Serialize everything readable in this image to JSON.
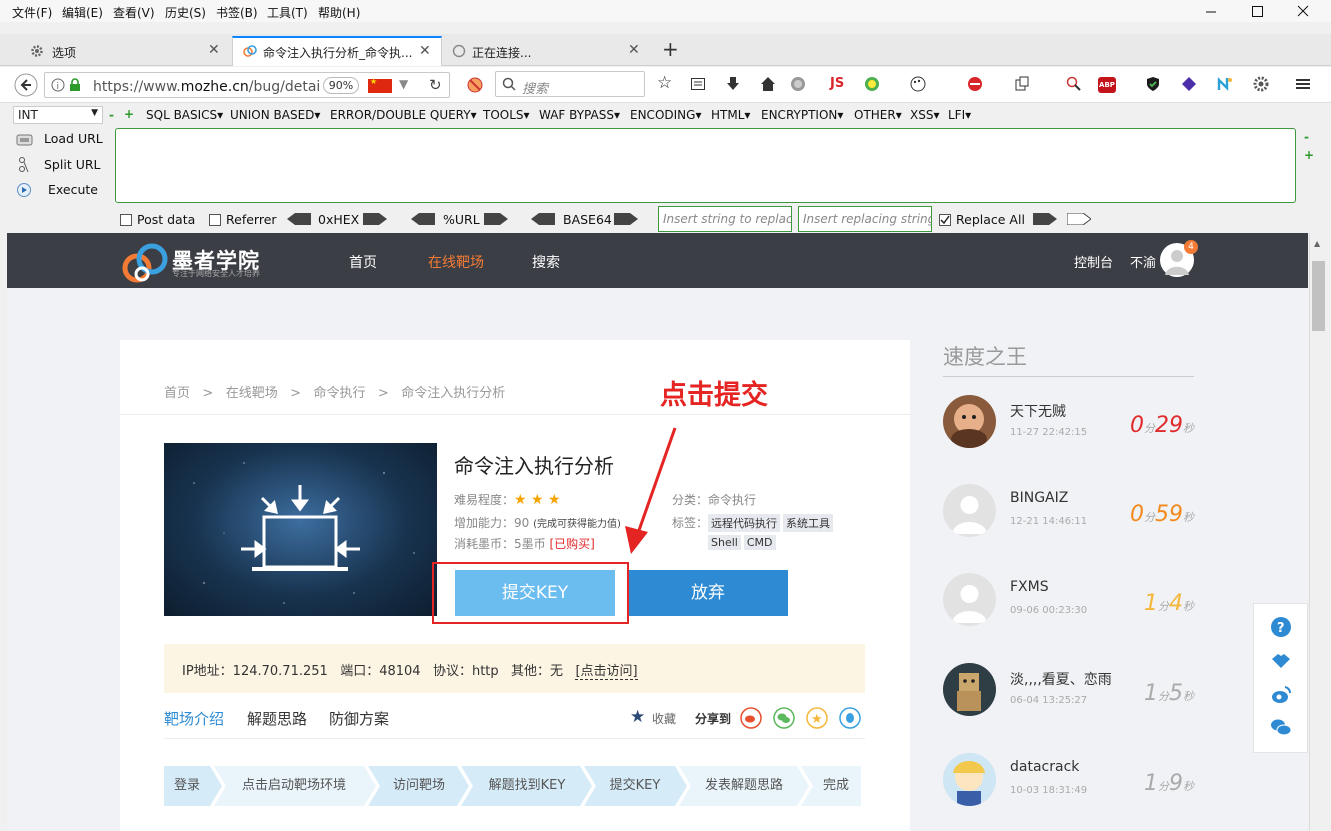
{
  "menubar": [
    "文件(F)",
    "编辑(E)",
    "查看(V)",
    "历史(S)",
    "书签(B)",
    "工具(T)",
    "帮助(H)"
  ],
  "tabs": [
    {
      "label": "选项",
      "icon": "gear-icon"
    },
    {
      "label": "命令注入执行分析_命令执...",
      "icon": "site-logo-icon"
    },
    {
      "label": "正在连接...",
      "icon": "loading-icon"
    }
  ],
  "new_tab": "+",
  "address": {
    "url_host_prefix": "https://www.",
    "url_host": "mozhe.cn",
    "url_path": "/bug/detai",
    "zoom": "90%"
  },
  "search": {
    "placeholder": "搜索"
  },
  "toolbar_badges": {
    "js": "JS",
    "abp": "ABP"
  },
  "hackbar": {
    "select": "INT",
    "menus": [
      "SQL BASICS▾",
      "UNION BASED▾",
      "ERROR/DOUBLE QUERY▾",
      "TOOLS▾",
      "WAF BYPASS▾",
      "ENCODING▾",
      "HTML▾",
      "ENCRYPTION▾",
      "OTHER▾",
      "XSS▾",
      "LFI▾"
    ],
    "actions": [
      "Load URL",
      "Split URL",
      "Execute"
    ],
    "post_data": "Post data",
    "referrer": "Referrer",
    "hex": "0xHEX",
    "url": "%URL",
    "base64": "BASE64",
    "find_placeholder": "Insert string to replace",
    "replace_placeholder": "Insert replacing string",
    "replace_all": "Replace All"
  },
  "site": {
    "logo": "墨者学院",
    "logo_sub": "专注于网络安全人才培养",
    "nav": [
      "首页",
      "在线靶场",
      "搜索"
    ],
    "console": "控制台",
    "user": "不渝",
    "badge": "4",
    "accent": "#f47b35"
  },
  "breadcrumb": [
    "首页",
    ">",
    "在线靶场",
    ">",
    "命令执行",
    ">",
    "命令注入执行分析"
  ],
  "challenge": {
    "title": "命令注入执行分析",
    "difficulty_label": "难易程度：",
    "stars": "★ ★ ★",
    "ability": "增加能力：90",
    "ability_note": "(完成可获得能力值)",
    "cost": "消耗墨币：5墨币",
    "bought": "[已购买]",
    "category": "分类：命令执行",
    "tags_label": "标签：",
    "tags": [
      "远程代码执行",
      "系统工具",
      "Shell",
      "CMD"
    ],
    "submit": "提交KEY",
    "give_up": "放弃",
    "annotation": "点击提交"
  },
  "server_info": {
    "ip": "IP地址：124.70.71.251",
    "port": "端口：48104",
    "protocol": "协议：http",
    "other": "其他：无",
    "link": "[点击访问]"
  },
  "subtabs": [
    "靶场介绍",
    "解题思路",
    "防御方案"
  ],
  "share": {
    "collect": "收藏",
    "share_to": "分享到"
  },
  "steps": [
    "登录",
    "点击启动靶场环境",
    "访问靶场",
    "解题找到KEY",
    "提交KEY",
    "发表解题思路",
    "完成"
  ],
  "leaderboard": {
    "title": "速度之王",
    "items": [
      {
        "name": "天下无贼",
        "time": "11-27 22:42:15",
        "min": "0",
        "sec": "29",
        "color": "#e02b2b"
      },
      {
        "name": "BINGAIZ",
        "time": "12-21 14:46:11",
        "min": "0",
        "sec": "59",
        "color": "#f28a1e"
      },
      {
        "name": "FXMS",
        "time": "09-06 00:23:30",
        "min": "1",
        "sec": "4",
        "color": "#f4b73a"
      },
      {
        "name": "淡,,,,看夏、恋雨",
        "time": "06-04 13:25:27",
        "min": "1",
        "sec": "5",
        "color": "#aaaaaa"
      },
      {
        "name": "datacrack",
        "time": "10-03 18:31:49",
        "min": "1",
        "sec": "9",
        "color": "#aaaaaa"
      }
    ],
    "unit_min": "分",
    "unit_sec": "秒"
  }
}
